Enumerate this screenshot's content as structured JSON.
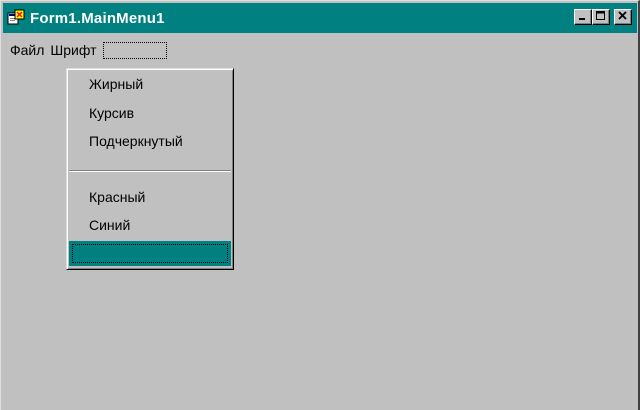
{
  "window": {
    "title": "Form1.MainMenu1",
    "controls": {
      "minimize_icon": "minimize-icon",
      "restore_icon": "restore-icon",
      "close_icon": "close-icon"
    },
    "app_icon": "form-designer-icon"
  },
  "menubar": {
    "items": [
      {
        "label": "Файл"
      },
      {
        "label": "Шрифт"
      },
      {
        "label": ""
      }
    ]
  },
  "dropdown": {
    "items": [
      {
        "label": "Жирный"
      },
      {
        "label": "Курсив"
      },
      {
        "label": "Подчеркнутый"
      },
      {
        "separator": true
      },
      {
        "label": "Красный"
      },
      {
        "label": "Синий"
      },
      {
        "label": "",
        "selected": true
      }
    ]
  },
  "colors": {
    "titlebar": "#008080",
    "face": "#c0c0c0",
    "highlight": "#008080",
    "text": "#000000"
  }
}
